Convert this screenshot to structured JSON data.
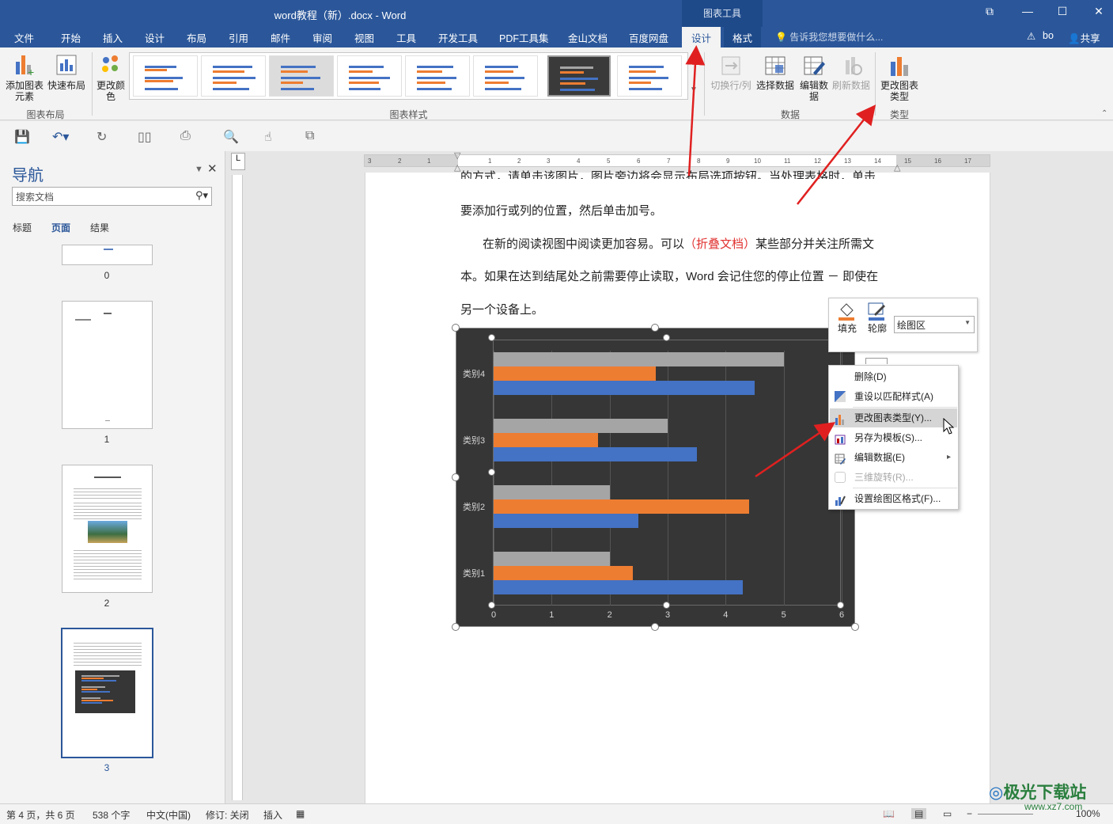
{
  "window": {
    "title": "word教程（新）.docx - Word",
    "context_tab_group": "图表工具",
    "user": "bo",
    "share": "共享",
    "tell_me": "告诉我您想要做什么..."
  },
  "tabs": [
    "文件",
    "开始",
    "插入",
    "设计",
    "布局",
    "引用",
    "邮件",
    "审阅",
    "视图",
    "工具",
    "开发工具",
    "PDF工具集",
    "金山文档",
    "百度网盘",
    "设计",
    "格式"
  ],
  "ribbon": {
    "add_element": "添加图表元素",
    "quick_layout": "快速布局",
    "change_colors": "更改颜色",
    "group_layout": "图表布局",
    "group_styles": "图表样式",
    "switch_row_col": "切换行/列",
    "select_data": "选择数据",
    "edit_data": "编辑数据",
    "refresh_data": "刷新数据",
    "group_data": "数据",
    "change_type": "更改图表类型",
    "group_type": "类型"
  },
  "nav": {
    "title": "导航",
    "search_placeholder": "搜索文档",
    "tabs": [
      "标题",
      "页面",
      "结果"
    ],
    "pages": [
      "0",
      "1",
      "2",
      "3"
    ]
  },
  "document": {
    "line1": "的方式，请单击该图片，图片旁边将会显示布局选项按钮。当处理表格时，单击",
    "line2": "要添加行或列的位置，然后单击加号。",
    "line3_pre": "在新的阅读视图中阅读更加容易。可以",
    "line3_red": "（折叠文档）",
    "line3_post": "某些部分并关注所需文",
    "line4": "本。如果在达到结尾处之前需要停止读取，Word 会记住您的停止位置 － 即使在",
    "line5": "另一个设备上。"
  },
  "chart_data": {
    "type": "bar",
    "orientation": "horizontal",
    "categories": [
      "类别1",
      "类别2",
      "类别3",
      "类别4"
    ],
    "series": [
      {
        "color": "#4472c4",
        "values": [
          4.3,
          2.5,
          3.5,
          4.5
        ]
      },
      {
        "color": "#ed7d31",
        "values": [
          2.4,
          4.4,
          1.8,
          2.8
        ]
      },
      {
        "color": "#a5a5a5",
        "values": [
          2.0,
          2.0,
          3.0,
          5.0
        ]
      }
    ],
    "xlim": [
      0,
      6
    ],
    "xticks": [
      "0",
      "1",
      "2",
      "3",
      "4",
      "5",
      "6"
    ],
    "grid": true,
    "background": "#363636"
  },
  "minitoolbar": {
    "fill": "填充",
    "outline": "轮廓",
    "element": "绘图区"
  },
  "context_menu": {
    "items": [
      {
        "label": "删除(D)",
        "enabled": true
      },
      {
        "label": "重设以匹配样式(A)",
        "enabled": true
      },
      {
        "label": "更改图表类型(Y)...",
        "enabled": true
      },
      {
        "label": "另存为模板(S)...",
        "enabled": true
      },
      {
        "label": "编辑数据(E)",
        "enabled": true
      },
      {
        "label": "三维旋转(R)...",
        "enabled": false
      },
      {
        "label": "设置绘图区格式(F)...",
        "enabled": true
      }
    ]
  },
  "status": {
    "page": "第 4 页，共 6 页",
    "words": "538 个字",
    "lang": "中文(中国)",
    "track": "修订: 关闭",
    "mode": "插入",
    "zoom": "100%"
  },
  "watermark": {
    "brand": "极光下载站",
    "url": "www.xz7.com"
  },
  "colors": {
    "accent": "#2b579a",
    "arrow": "#e02020"
  }
}
